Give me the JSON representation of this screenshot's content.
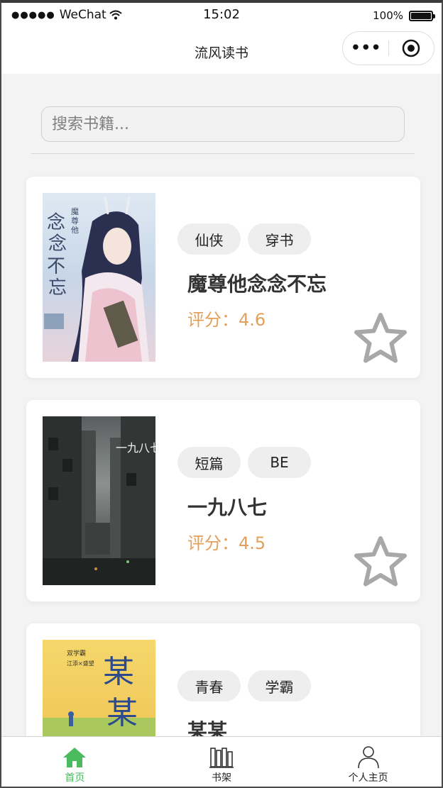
{
  "status_bar": {
    "carrier": "WeChat",
    "time": "15:02",
    "battery": "100%"
  },
  "nav": {
    "title": "流风读书"
  },
  "search": {
    "placeholder": "搜索书籍..."
  },
  "books": [
    {
      "tags": [
        "仙侠",
        "穿书"
      ],
      "title": "魔尊他念念不忘",
      "score": "评分：4.6",
      "cover_text": [
        "念念不忘",
        "魔尊他"
      ]
    },
    {
      "tags": [
        "短篇",
        "BE"
      ],
      "title": "一九八七",
      "score": "评分：4.5",
      "cover_text": [
        "一九八七"
      ]
    },
    {
      "tags": [
        "青春",
        "学霸"
      ],
      "title": "某某",
      "score": "",
      "cover_text": [
        "某某",
        "双学霸",
        "江添×盛望"
      ]
    }
  ],
  "tabbar": {
    "items": [
      {
        "label": "首页",
        "icon": "home-icon",
        "active": true
      },
      {
        "label": "书架",
        "icon": "bookshelf-icon",
        "active": false
      },
      {
        "label": "个人主页",
        "icon": "person-icon",
        "active": false
      }
    ]
  },
  "colors": {
    "accent": "#4cba5e",
    "score": "#e3a05a",
    "background": "#f3f3f3"
  }
}
